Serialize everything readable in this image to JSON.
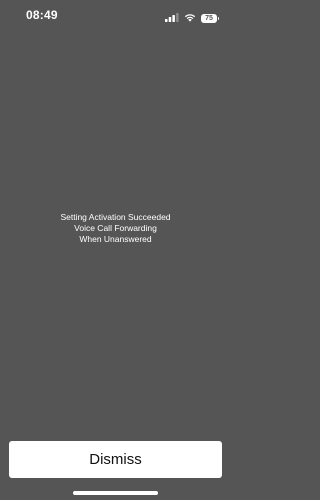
{
  "status_bar": {
    "time": "08:49",
    "signal_icon": "cellular-signal-icon",
    "wifi_icon": "wifi-icon",
    "battery_level": "75"
  },
  "message": {
    "line1": "Setting Activation Succeeded",
    "line2": "Voice Call Forwarding",
    "line3": "When Unanswered"
  },
  "actions": {
    "dismiss_label": "Dismiss"
  },
  "colors": {
    "background": "#555555",
    "text": "#ffffff",
    "button_bg": "#ffffff"
  }
}
